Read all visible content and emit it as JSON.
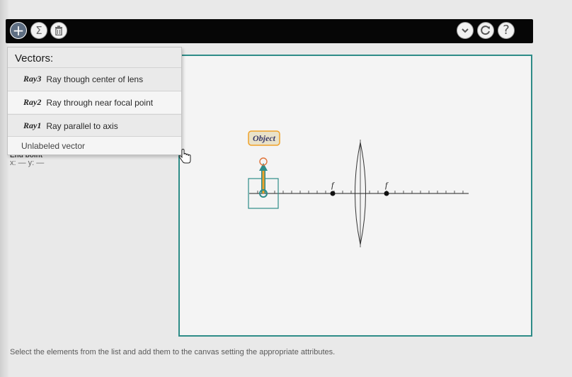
{
  "toolbar": {
    "left_buttons": [
      {
        "icon": "plus-icon",
        "glyph": "+"
      },
      {
        "icon": "sigma-icon",
        "glyph": "Σ"
      },
      {
        "icon": "trash-icon",
        "glyph": "🗑"
      }
    ],
    "right_buttons": [
      {
        "icon": "chevron-down-icon",
        "glyph": "⌄"
      },
      {
        "icon": "refresh-icon",
        "glyph": "⟳"
      },
      {
        "icon": "help-icon",
        "glyph": "?"
      }
    ]
  },
  "vectors_menu": {
    "header": "Vectors:",
    "items": [
      {
        "id": "Ray3",
        "label": "Ray though center of lens"
      },
      {
        "id": "Ray2",
        "label": "Ray through near focal point"
      },
      {
        "id": "Ray1",
        "label": "Ray parallel to axis"
      }
    ],
    "unlabeled": "Unlabeled vector"
  },
  "properties": {
    "end_point_label": "End point",
    "coords": "x: — y: —"
  },
  "canvas": {
    "object_label": "Object",
    "focal_left": "f",
    "focal_right": "f"
  },
  "instructions": "Select the elements from the list and add them to the canvas setting the appropriate attributes.",
  "colors": {
    "accent": "#2e8c88",
    "object_vector": "#f0a229",
    "toolbar": "#060606"
  }
}
